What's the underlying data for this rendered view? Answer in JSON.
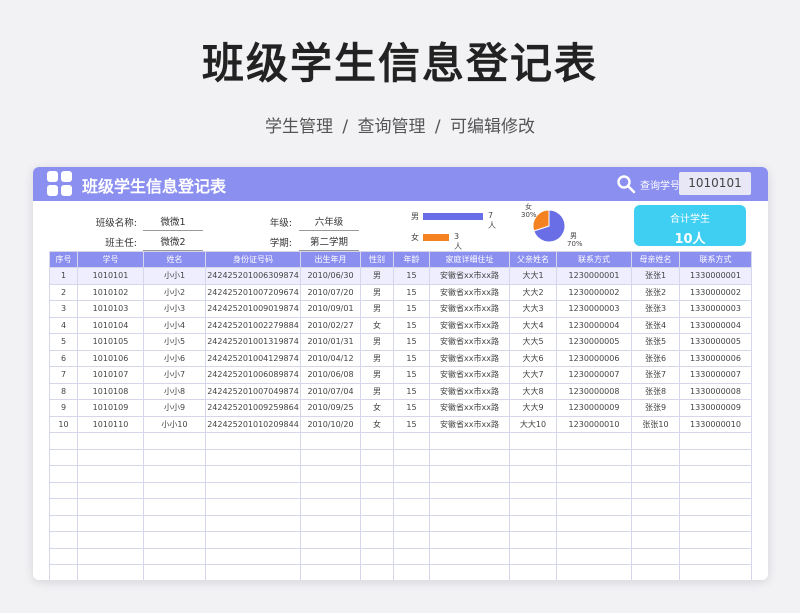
{
  "page": {
    "title": "班级学生信息登记表",
    "subtitle": "学生管理 / 查询管理 / 可编辑修改"
  },
  "header": {
    "title": "班级学生信息登记表",
    "search_label": "查询学号",
    "search_value": "1010101"
  },
  "info": {
    "class_name_label": "班级名称:",
    "class_name_value": "微微1",
    "grade_label": "年级:",
    "grade_value": "六年级",
    "teacher_label": "班主任:",
    "teacher_value": "微微2",
    "semester_label": "学期:",
    "semester_value": "第二学期"
  },
  "gender_bars": [
    {
      "label": "男",
      "value": 7,
      "text": "7人",
      "color": "#6a6ee6"
    },
    {
      "label": "女",
      "value": 3,
      "text": "3人",
      "color": "#f58220"
    }
  ],
  "gender_pie": {
    "slices": [
      {
        "label": "男",
        "pct_text": "70%",
        "value": 70,
        "color": "#6a6ee6"
      },
      {
        "label": "女",
        "pct_text": "30%",
        "value": 30,
        "color": "#f58220"
      }
    ]
  },
  "summary": {
    "label": "合计学生",
    "value": "10人"
  },
  "table": {
    "columns": [
      "序号",
      "学号",
      "姓名",
      "身份证号码",
      "出生年月",
      "性别",
      "年龄",
      "家庭详细住址",
      "父亲姓名",
      "联系方式",
      "母亲姓名",
      "联系方式"
    ],
    "rows": [
      [
        "1",
        "1010101",
        "小小1",
        "242425201006309874",
        "2010/06/30",
        "男",
        "15",
        "安徽省xx市xx路",
        "大大1",
        "1230000001",
        "张张1",
        "1330000001"
      ],
      [
        "2",
        "1010102",
        "小小2",
        "242425201007209674",
        "2010/07/20",
        "男",
        "15",
        "安徽省xx市xx路",
        "大大2",
        "1230000002",
        "张张2",
        "1330000002"
      ],
      [
        "3",
        "1010103",
        "小小3",
        "242425201009019874",
        "2010/09/01",
        "男",
        "15",
        "安徽省xx市xx路",
        "大大3",
        "1230000003",
        "张张3",
        "1330000003"
      ],
      [
        "4",
        "1010104",
        "小小4",
        "242425201002279884",
        "2010/02/27",
        "女",
        "15",
        "安徽省xx市xx路",
        "大大4",
        "1230000004",
        "张张4",
        "1330000004"
      ],
      [
        "5",
        "1010105",
        "小小5",
        "242425201001319874",
        "2010/01/31",
        "男",
        "15",
        "安徽省xx市xx路",
        "大大5",
        "1230000005",
        "张张5",
        "1330000005"
      ],
      [
        "6",
        "1010106",
        "小小6",
        "242425201004129874",
        "2010/04/12",
        "男",
        "15",
        "安徽省xx市xx路",
        "大大6",
        "1230000006",
        "张张6",
        "1330000006"
      ],
      [
        "7",
        "1010107",
        "小小7",
        "242425201006089874",
        "2010/06/08",
        "男",
        "15",
        "安徽省xx市xx路",
        "大大7",
        "1230000007",
        "张张7",
        "1330000007"
      ],
      [
        "8",
        "1010108",
        "小小8",
        "242425201007049874",
        "2010/07/04",
        "男",
        "15",
        "安徽省xx市xx路",
        "大大8",
        "1230000008",
        "张张8",
        "1330000008"
      ],
      [
        "9",
        "1010109",
        "小小9",
        "242425201009259864",
        "2010/09/25",
        "女",
        "15",
        "安徽省xx市xx路",
        "大大9",
        "1230000009",
        "张张9",
        "1330000009"
      ],
      [
        "10",
        "1010110",
        "小小10",
        "242425201010209844",
        "2010/10/20",
        "女",
        "15",
        "安徽省xx市xx路",
        "大大10",
        "1230000010",
        "张张10",
        "1330000010"
      ]
    ],
    "selected_row": 0,
    "empty_rows": 9
  }
}
